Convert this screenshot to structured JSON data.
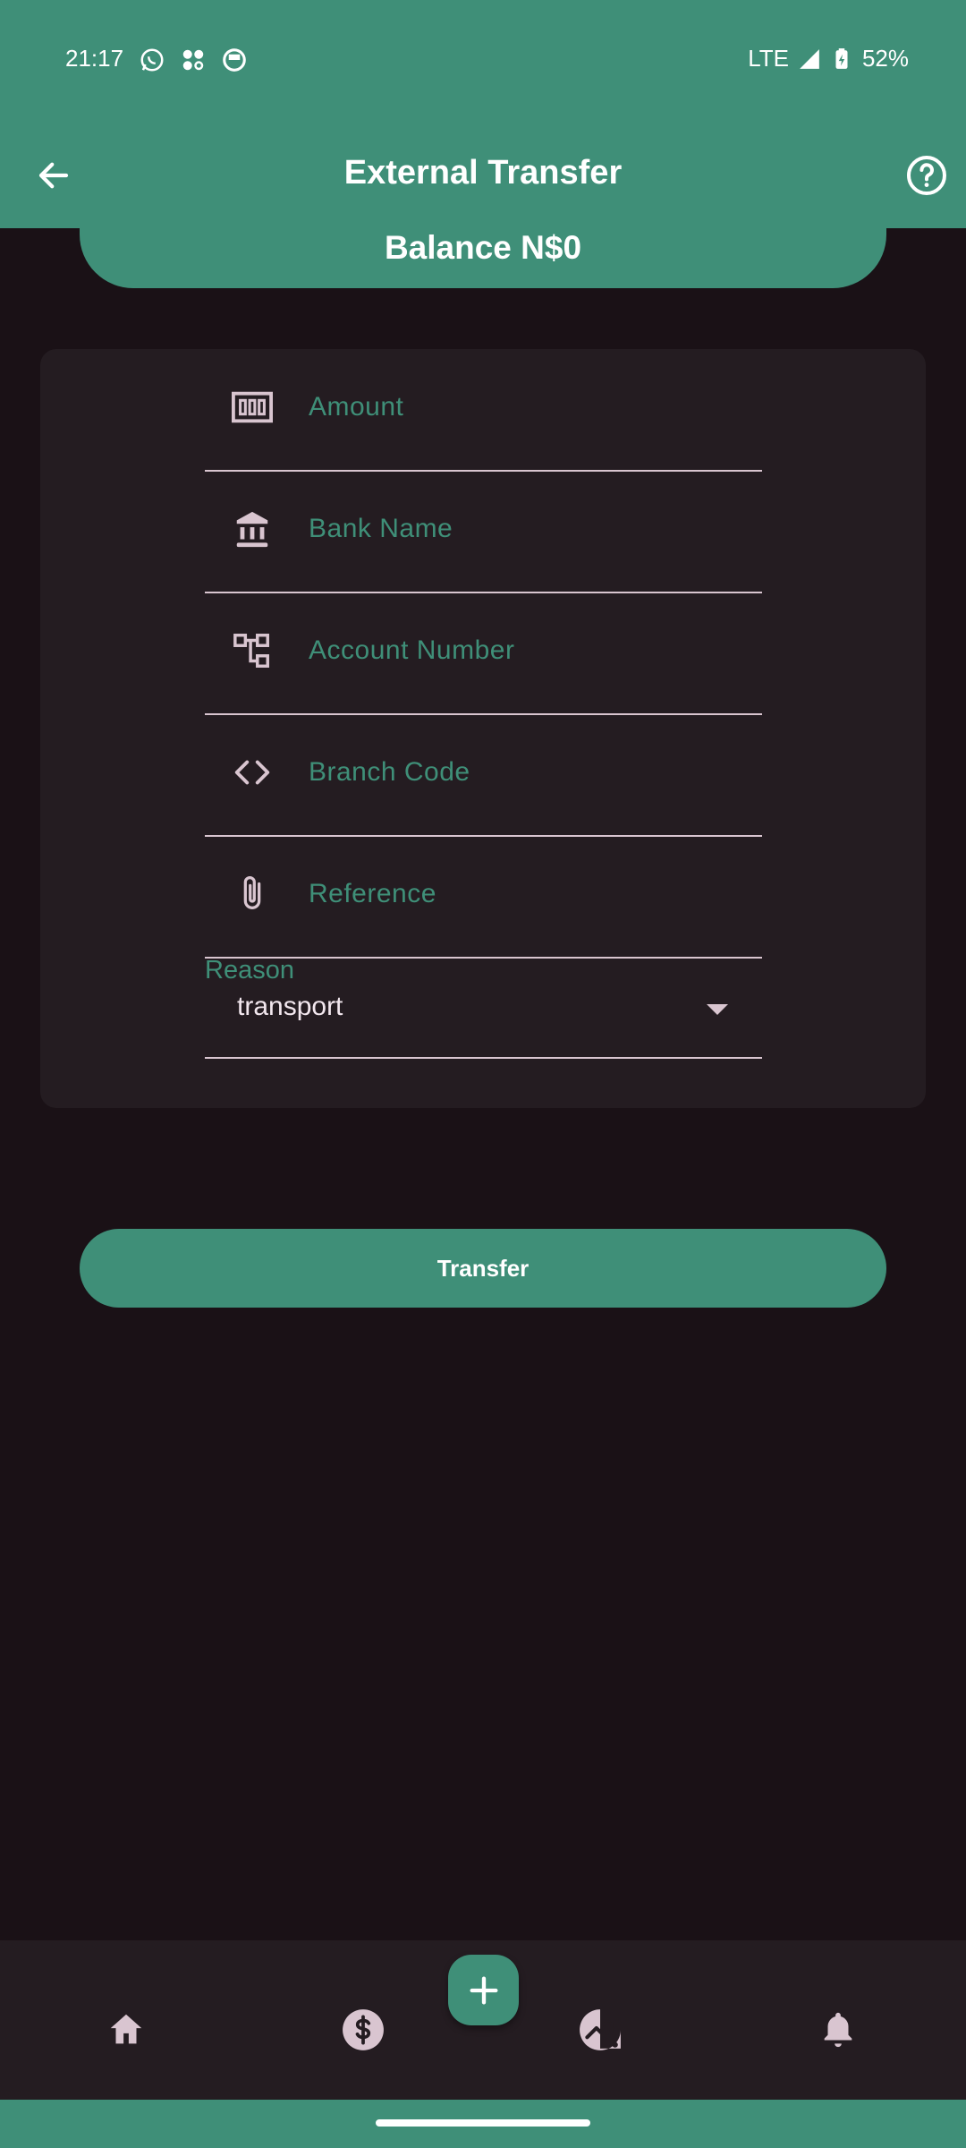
{
  "status_bar": {
    "time": "21:17",
    "network": "LTE",
    "battery": "52%",
    "notification_icons": [
      "whatsapp-icon",
      "music-icon",
      "app-icon"
    ]
  },
  "app_bar": {
    "title": "External Transfer",
    "back_icon": "arrow-back-icon",
    "help_icon": "help-circle-icon"
  },
  "balance": {
    "text": "Balance N$0"
  },
  "form": {
    "fields": [
      {
        "label": "Amount",
        "icon": "money-icon"
      },
      {
        "label": "Bank Name",
        "icon": "bank-icon"
      },
      {
        "label": "Account Number",
        "icon": "account-tree-icon"
      },
      {
        "label": "Branch Code",
        "icon": "code-icon"
      },
      {
        "label": "Reference",
        "icon": "attachment-icon"
      }
    ],
    "reason": {
      "label": "Reason",
      "value": "transport"
    }
  },
  "transfer_button": {
    "label": "Transfer"
  },
  "bottom_nav": {
    "items": [
      "home-icon",
      "dollar-icon",
      "trending-icon",
      "bell-icon"
    ],
    "fab_icon": "plus-icon"
  },
  "colors": {
    "primary": "#3f8f78",
    "background": "#1a1116",
    "surface": "#241c21",
    "icon_tint": "#d9c5d0"
  }
}
